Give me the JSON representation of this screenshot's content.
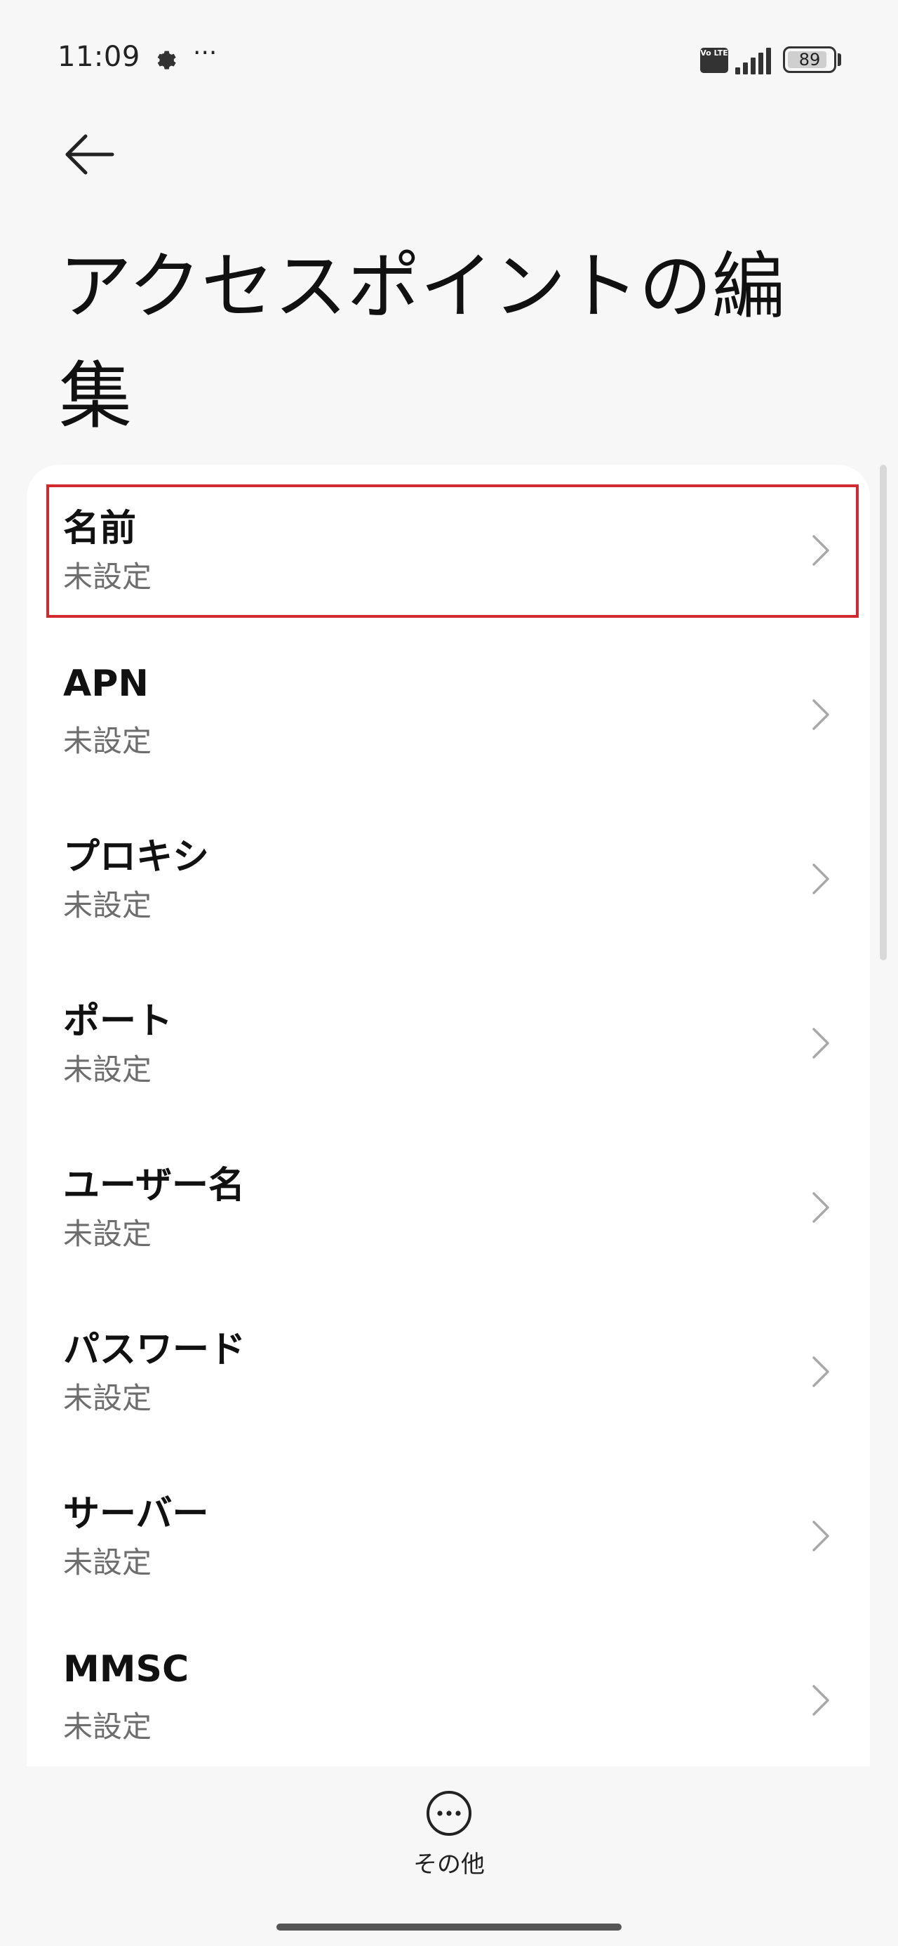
{
  "status_bar": {
    "time": "11:09",
    "more": "···",
    "volte": "Vo LTE",
    "battery": "89",
    "battery_level": 0.89
  },
  "header": {
    "title": "アクセスポイントの編集"
  },
  "items": [
    {
      "title": "名前",
      "value": "未設定"
    },
    {
      "title": "APN",
      "value": "未設定"
    },
    {
      "title": "プロキシ",
      "value": "未設定"
    },
    {
      "title": "ポート",
      "value": "未設定"
    },
    {
      "title": "ユーザー名",
      "value": "未設定"
    },
    {
      "title": "パスワード",
      "value": "未設定"
    },
    {
      "title": "サーバー",
      "value": "未設定"
    },
    {
      "title": "MMSC",
      "value": "未設定"
    }
  ],
  "bottom": {
    "more_label": "その他"
  },
  "colors": {
    "highlight": "#d2282f",
    "background": "#f7f7f7",
    "card": "#ffffff"
  }
}
